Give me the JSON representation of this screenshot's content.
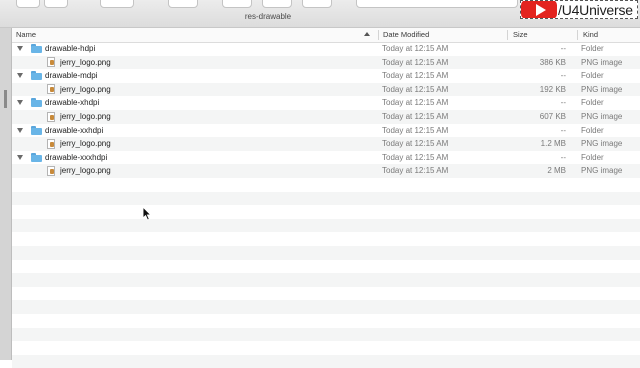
{
  "window": {
    "title": "res-drawable"
  },
  "watermark": {
    "text": "/U4Universe",
    "icon": "youtube-play-icon",
    "color": "#e3241f"
  },
  "columns": {
    "name": "Name",
    "date": "Date Modified",
    "size": "Size",
    "kind": "Kind"
  },
  "rows": [
    {
      "type": "folder",
      "name": "drawable-hdpi",
      "date": "Today at 12:15 AM",
      "size": "--",
      "kind": "Folder",
      "expanded": true
    },
    {
      "type": "file",
      "name": "jerry_logo.png",
      "date": "Today at 12:15 AM",
      "size": "386 KB",
      "kind": "PNG image"
    },
    {
      "type": "folder",
      "name": "drawable-mdpi",
      "date": "Today at 12:15 AM",
      "size": "--",
      "kind": "Folder",
      "expanded": true
    },
    {
      "type": "file",
      "name": "jerry_logo.png",
      "date": "Today at 12:15 AM",
      "size": "192 KB",
      "kind": "PNG image"
    },
    {
      "type": "folder",
      "name": "drawable-xhdpi",
      "date": "Today at 12:15 AM",
      "size": "--",
      "kind": "Folder",
      "expanded": true
    },
    {
      "type": "file",
      "name": "jerry_logo.png",
      "date": "Today at 12:15 AM",
      "size": "607 KB",
      "kind": "PNG image"
    },
    {
      "type": "folder",
      "name": "drawable-xxhdpi",
      "date": "Today at 12:15 AM",
      "size": "--",
      "kind": "Folder",
      "expanded": true
    },
    {
      "type": "file",
      "name": "jerry_logo.png",
      "date": "Today at 12:15 AM",
      "size": "1.2 MB",
      "kind": "PNG image"
    },
    {
      "type": "folder",
      "name": "drawable-xxxhdpi",
      "date": "Today at 12:15 AM",
      "size": "--",
      "kind": "Folder",
      "expanded": true
    },
    {
      "type": "file",
      "name": "jerry_logo.png",
      "date": "Today at 12:15 AM",
      "size": "2 MB",
      "kind": "PNG image"
    }
  ]
}
